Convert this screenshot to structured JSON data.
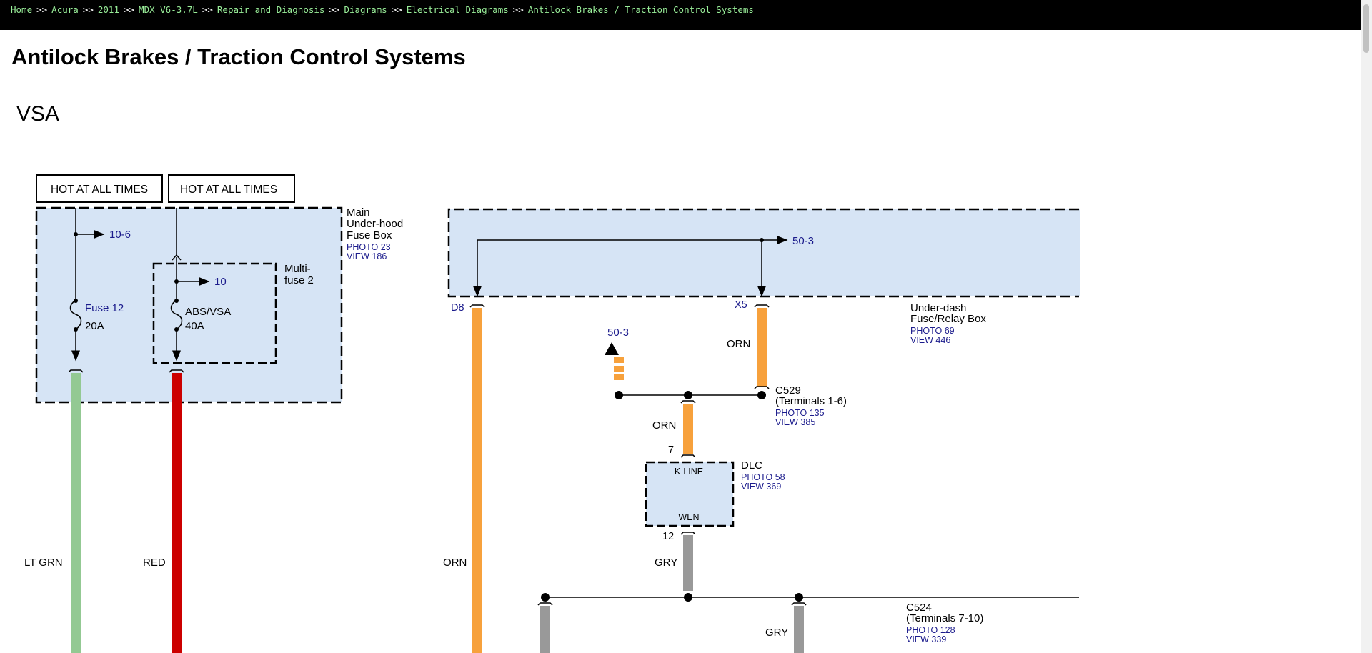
{
  "breadcrumb": [
    {
      "label": "Home"
    },
    {
      "label": "Acura"
    },
    {
      "label": "2011"
    },
    {
      "label": "MDX V6-3.7L"
    },
    {
      "label": "Repair and Diagnosis"
    },
    {
      "label": "Diagrams"
    },
    {
      "label": "Electrical Diagrams"
    },
    {
      "label": "Antilock Brakes / Traction Control Systems"
    }
  ],
  "breadcrumb_separator": ">>",
  "page_title": "Antilock Brakes / Traction Control Systems",
  "diagram": {
    "title": "VSA",
    "hot1": "HOT AT ALL TIMES",
    "hot2": "HOT AT ALL TIMES",
    "main_box": {
      "l1": "Main",
      "l2": "Under-hood",
      "l3": "Fuse Box",
      "photo": "PHOTO 23",
      "view": "VIEW 186"
    },
    "ref_10_6": "10-6",
    "fuse12": {
      "name": "Fuse 12",
      "rating": "20A"
    },
    "multifuse": {
      "l1": "Multi-",
      "l2": "fuse 2",
      "ref": "10",
      "name": "ABS/VSA",
      "rating": "40A"
    },
    "wire_ltgrn": "LT GRN",
    "wire_red": "RED",
    "dash_box": {
      "l1": "Under-dash",
      "l2": "Fuse/Relay Box",
      "photo": "PHOTO 69",
      "view": "VIEW 446"
    },
    "ref_50_3_top": "50-3",
    "pin_d8": "D8",
    "pin_x5": "X5",
    "wire_orn_left": "ORN",
    "wire_orn_x5": "ORN",
    "ref_50_3_arrow": "50-3",
    "c529": {
      "name": "C529",
      "terminals": "(Terminals 1-6)",
      "photo": "PHOTO 135",
      "view": "VIEW 385"
    },
    "wire_orn_dlc": "ORN",
    "dlc": {
      "pin_top": "7",
      "name": "DLC",
      "photo": "PHOTO 58",
      "view": "VIEW 369",
      "kline": "K-LINE",
      "wen": "WEN",
      "pin_bottom": "12"
    },
    "wire_gry_dlc": "GRY",
    "wire_gry_right": "GRY",
    "c524": {
      "name": "C524",
      "terminals": "(Terminals 7-10)",
      "photo": "PHOTO 128",
      "view": "VIEW 339"
    },
    "colors": {
      "box_fill": "#d6e4f5",
      "ltgrn": "#93c993",
      "red": "#cc0000",
      "orn": "#f7a13c",
      "gry": "#999999",
      "ref_blue": "#1b1b8c"
    }
  }
}
